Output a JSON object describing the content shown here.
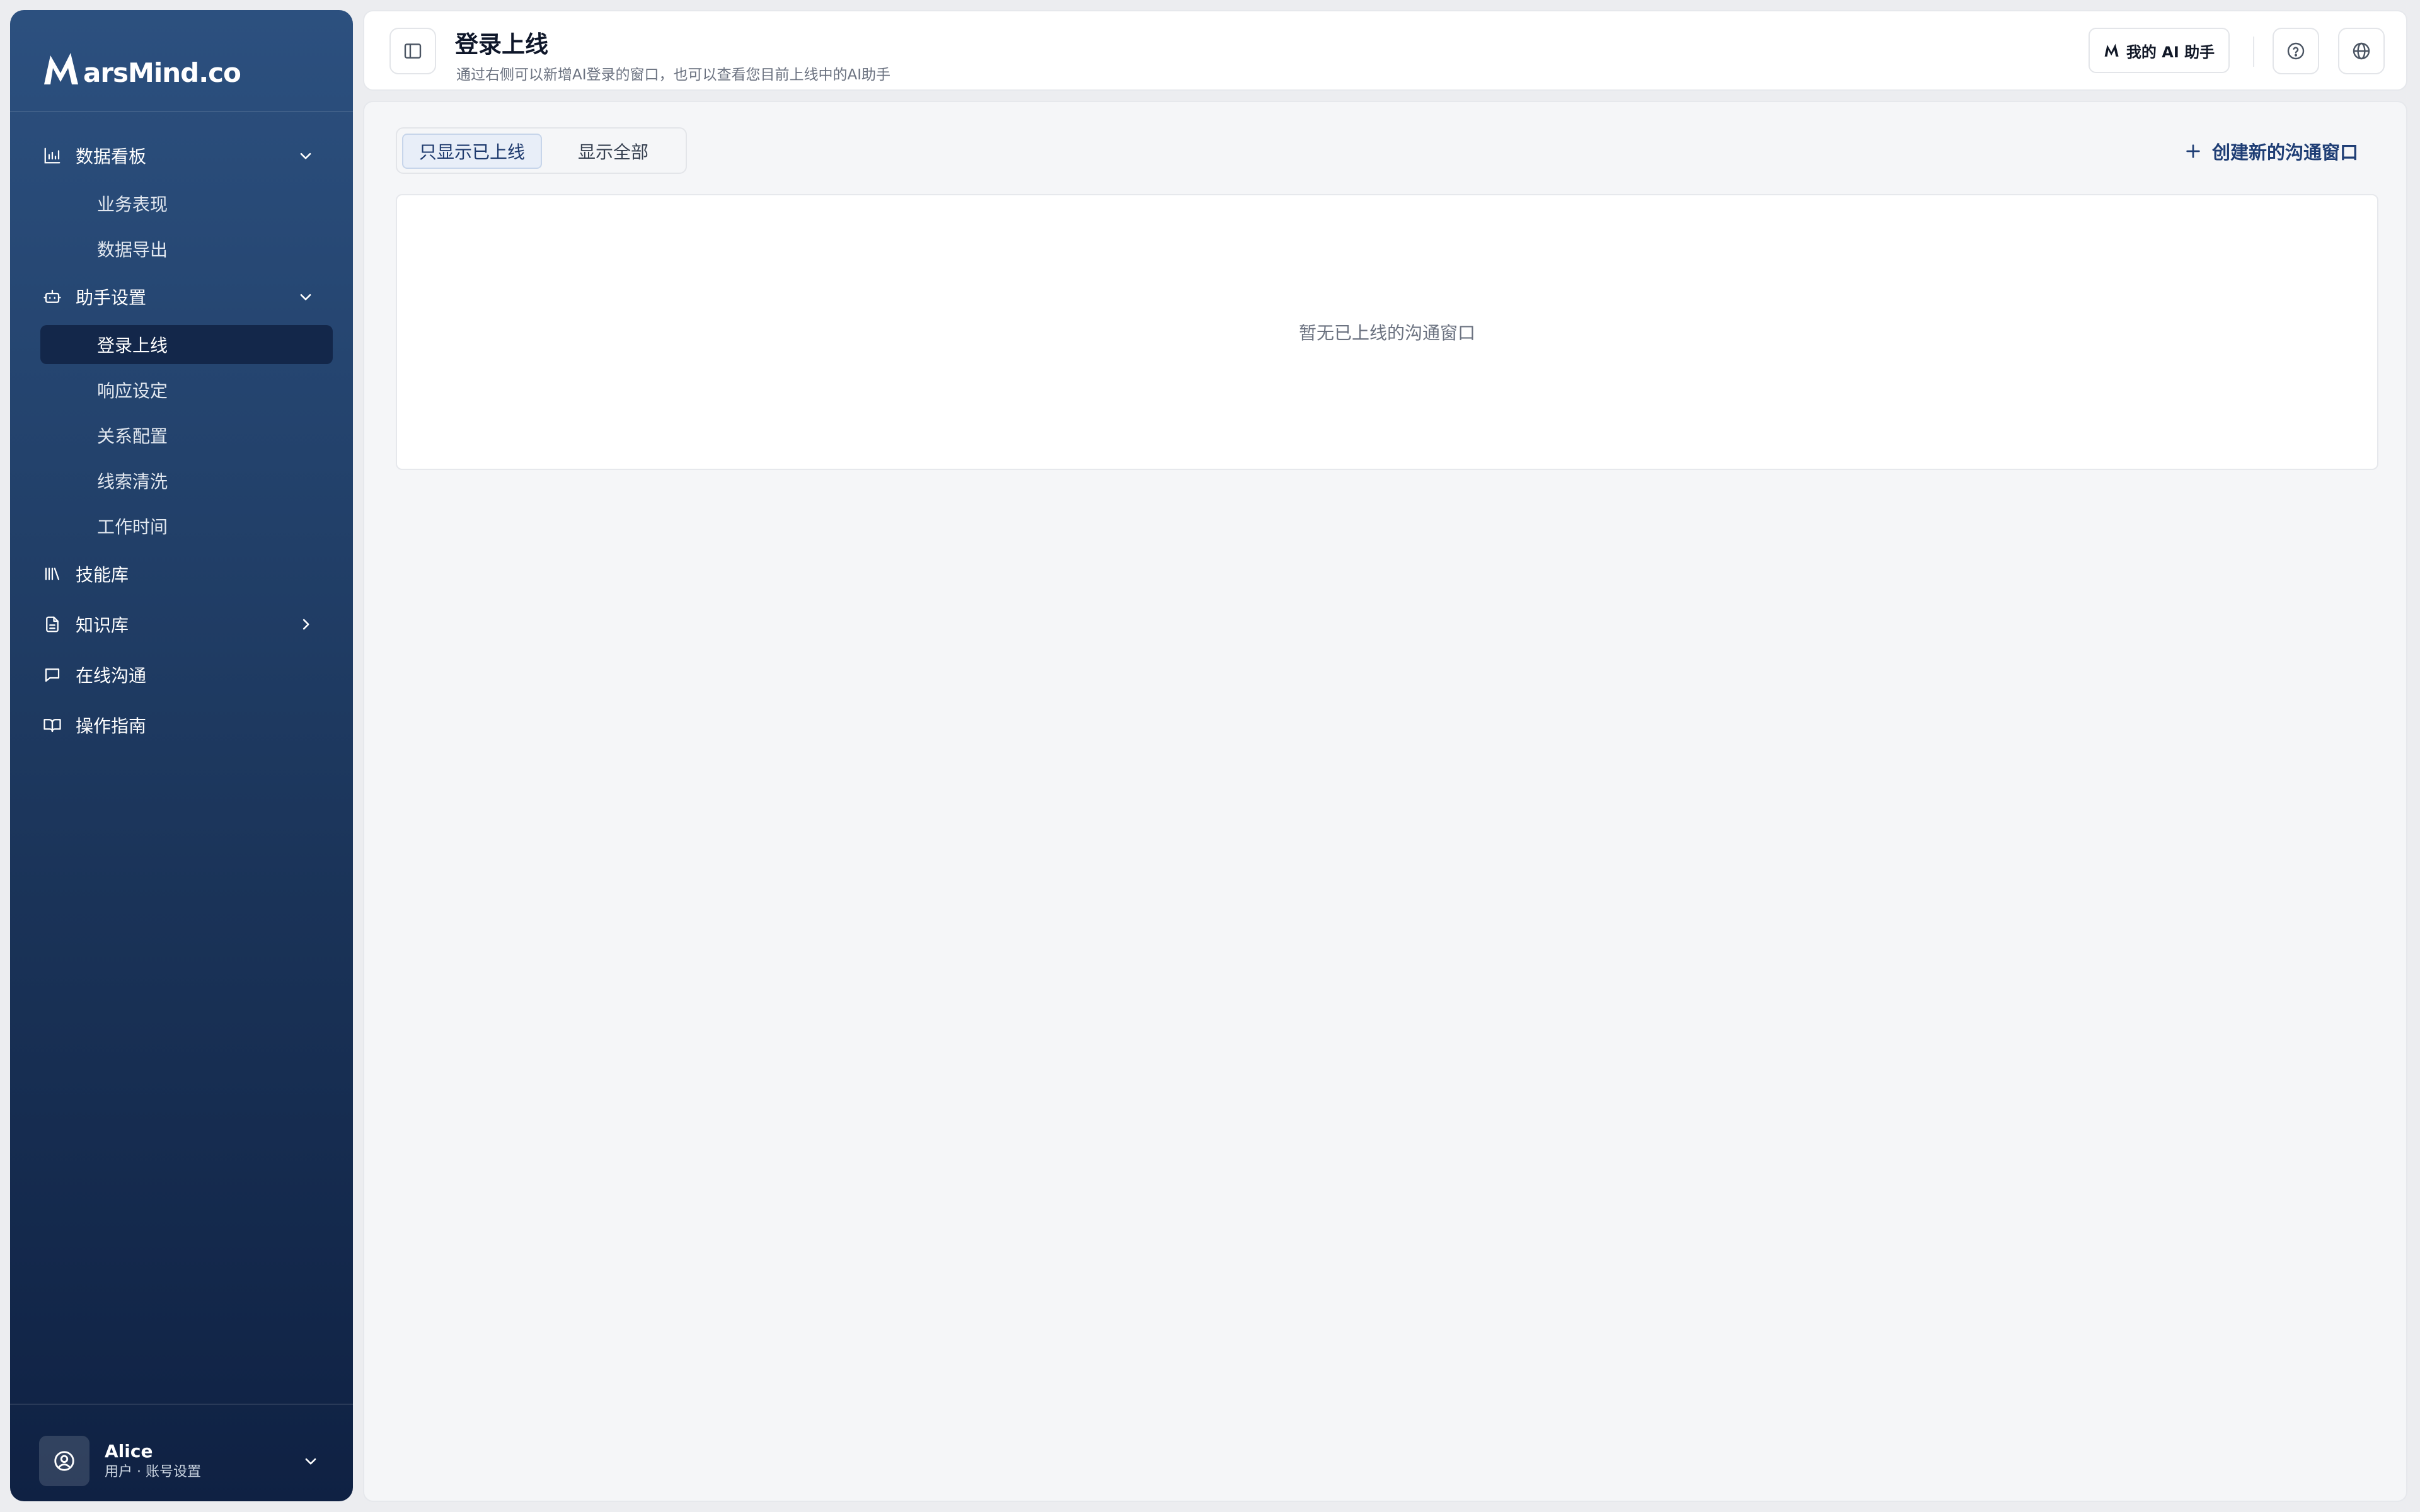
{
  "brand": {
    "logo_text": "arsMind.co"
  },
  "sidebar": {
    "groups": [
      {
        "label": "数据看板",
        "icon": "bar-chart-icon",
        "expanded": true,
        "items": [
          {
            "label": "业务表现"
          },
          {
            "label": "数据导出"
          }
        ]
      },
      {
        "label": "助手设置",
        "icon": "bot-icon",
        "expanded": true,
        "items": [
          {
            "label": "登录上线",
            "active": true
          },
          {
            "label": "响应设定"
          },
          {
            "label": "关系配置"
          },
          {
            "label": "线索清洗"
          },
          {
            "label": "工作时间"
          }
        ]
      }
    ],
    "links": [
      {
        "label": "技能库",
        "icon": "library-icon"
      },
      {
        "label": "知识库",
        "icon": "file-text-icon",
        "has_children": true
      },
      {
        "label": "在线沟通",
        "icon": "message-icon"
      },
      {
        "label": "操作指南",
        "icon": "book-open-icon"
      }
    ],
    "user": {
      "name": "Alice",
      "subtitle": "用户 · 账号设置"
    }
  },
  "header": {
    "title": "登录上线",
    "subtitle": "通过右侧可以新增AI登录的窗口，也可以查看您目前上线中的AI助手",
    "ai_button_label": "我的 AI 助手",
    "icons": [
      "sidebar-toggle-icon",
      "help-circle-icon",
      "globe-icon"
    ]
  },
  "main": {
    "filter": {
      "options": [
        "只显示已上线",
        "显示全部"
      ],
      "selected": "只显示已上线"
    },
    "create_label": "创建新的沟通窗口",
    "empty_text": "暂无已上线的沟通窗口"
  },
  "colors": {
    "sidebar_top": "#2c507f",
    "sidebar_bottom": "#0f2143",
    "accent": "#1f3e75",
    "active_item_bg": "#13274a"
  }
}
